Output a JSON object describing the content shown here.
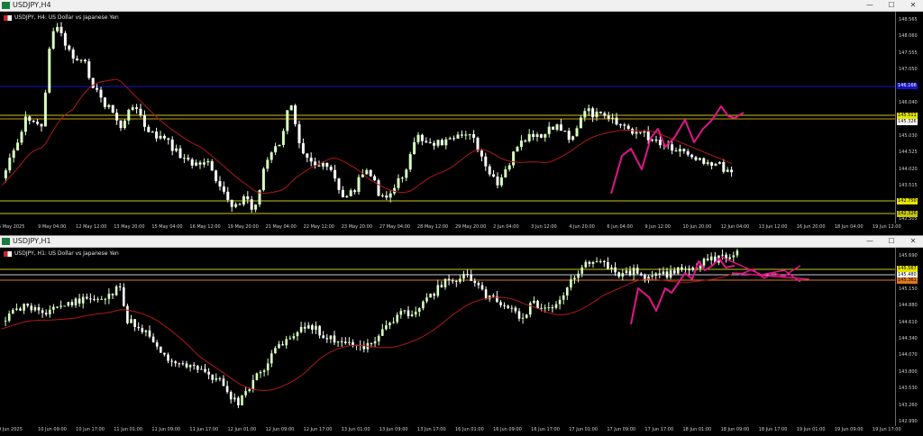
{
  "colors": {
    "bull": "#d8ffc0",
    "bear": "#ffffff",
    "ma": "#b21818",
    "trend": "#e0168a",
    "blueLine": "#1414c8",
    "yellowLine": "#c8c814",
    "orangeLine": "#e07818",
    "bg": "#000000"
  },
  "h4": {
    "window_title": "USDJPY,H4",
    "chart_label": "USDJPY, H4:  US Dollar vs Japanese Yen",
    "price_ticks": [
      "148.565",
      "148.060",
      "147.555",
      "147.050",
      "146.545",
      "146.040",
      "145.535",
      "145.030",
      "144.525",
      "144.020",
      "143.515",
      "143.010",
      "142.505"
    ],
    "price_tags": [
      {
        "text": "146.166",
        "bg": "#1414c8",
        "fg": "#ffffff"
      },
      {
        "text": "145.511",
        "bg": "#e6e600",
        "fg": "#000000"
      },
      {
        "text": "145.326",
        "bg": "#ffffff",
        "fg": "#000000"
      },
      {
        "text": "142.750",
        "bg": "#e6e600",
        "fg": "#000000"
      },
      {
        "text": "142.326",
        "bg": "#c8c800",
        "fg": "#000000"
      }
    ],
    "time_ticks": [
      "5 May 2025",
      "9 May 04:00",
      "12 May 12:00",
      "13 May 20:00",
      "15 May 04:00",
      "16 May 12:00",
      "19 May 20:00",
      "21 May 04:00",
      "22 May 12:00",
      "23 May 20:00",
      "27 May 04:00",
      "28 May 12:00",
      "29 May 20:00",
      "2 Jun 04:00",
      "3 Jun 12:00",
      "4 Jun 20:00",
      "6 Jun 04:00",
      "9 Jun 12:00",
      "10 Jun 20:00",
      "12 Jun 04:00",
      "13 Jun 12:00",
      "16 Jun 20:00",
      "18 Jun 04:00",
      "19 Jun 12:00"
    ]
  },
  "h1": {
    "window_title": "USDJPY,H1",
    "chart_label": "USDJPY, H1:  US Dollar vs Japanese Yen",
    "price_ticks": [
      "145.690",
      "145.420",
      "145.150",
      "144.880",
      "144.610",
      "144.340",
      "144.070",
      "143.800",
      "143.530",
      "143.260",
      "142.990"
    ],
    "price_tags": [
      {
        "text": "145.567",
        "bg": "#e6e600",
        "fg": "#000000"
      },
      {
        "text": "145.480",
        "bg": "#ffffff",
        "fg": "#000000"
      },
      {
        "text": "145.361",
        "bg": "#e07818",
        "fg": "#000000"
      }
    ],
    "time_ticks": [
      "9 Jun 2025",
      "10 Jun 09:00",
      "10 Jun 17:00",
      "11 Jun 01:00",
      "11 Jun 09:00",
      "11 Jun 17:00",
      "12 Jun 01:00",
      "12 Jun 09:00",
      "12 Jun 17:00",
      "13 Jun 01:00",
      "13 Jun 09:00",
      "13 Jun 17:00",
      "16 Jun 01:00",
      "16 Jun 09:00",
      "16 Jun 17:00",
      "17 Jun 01:00",
      "17 Jun 09:00",
      "17 Jun 17:00",
      "18 Jun 01:00",
      "18 Jun 09:00",
      "18 Jun 17:00",
      "19 Jun 01:00",
      "19 Jun 09:00",
      "19 Jun 17:00"
    ]
  },
  "controls": {
    "minimize": "—",
    "maximize": "☐",
    "close": "✕"
  }
}
